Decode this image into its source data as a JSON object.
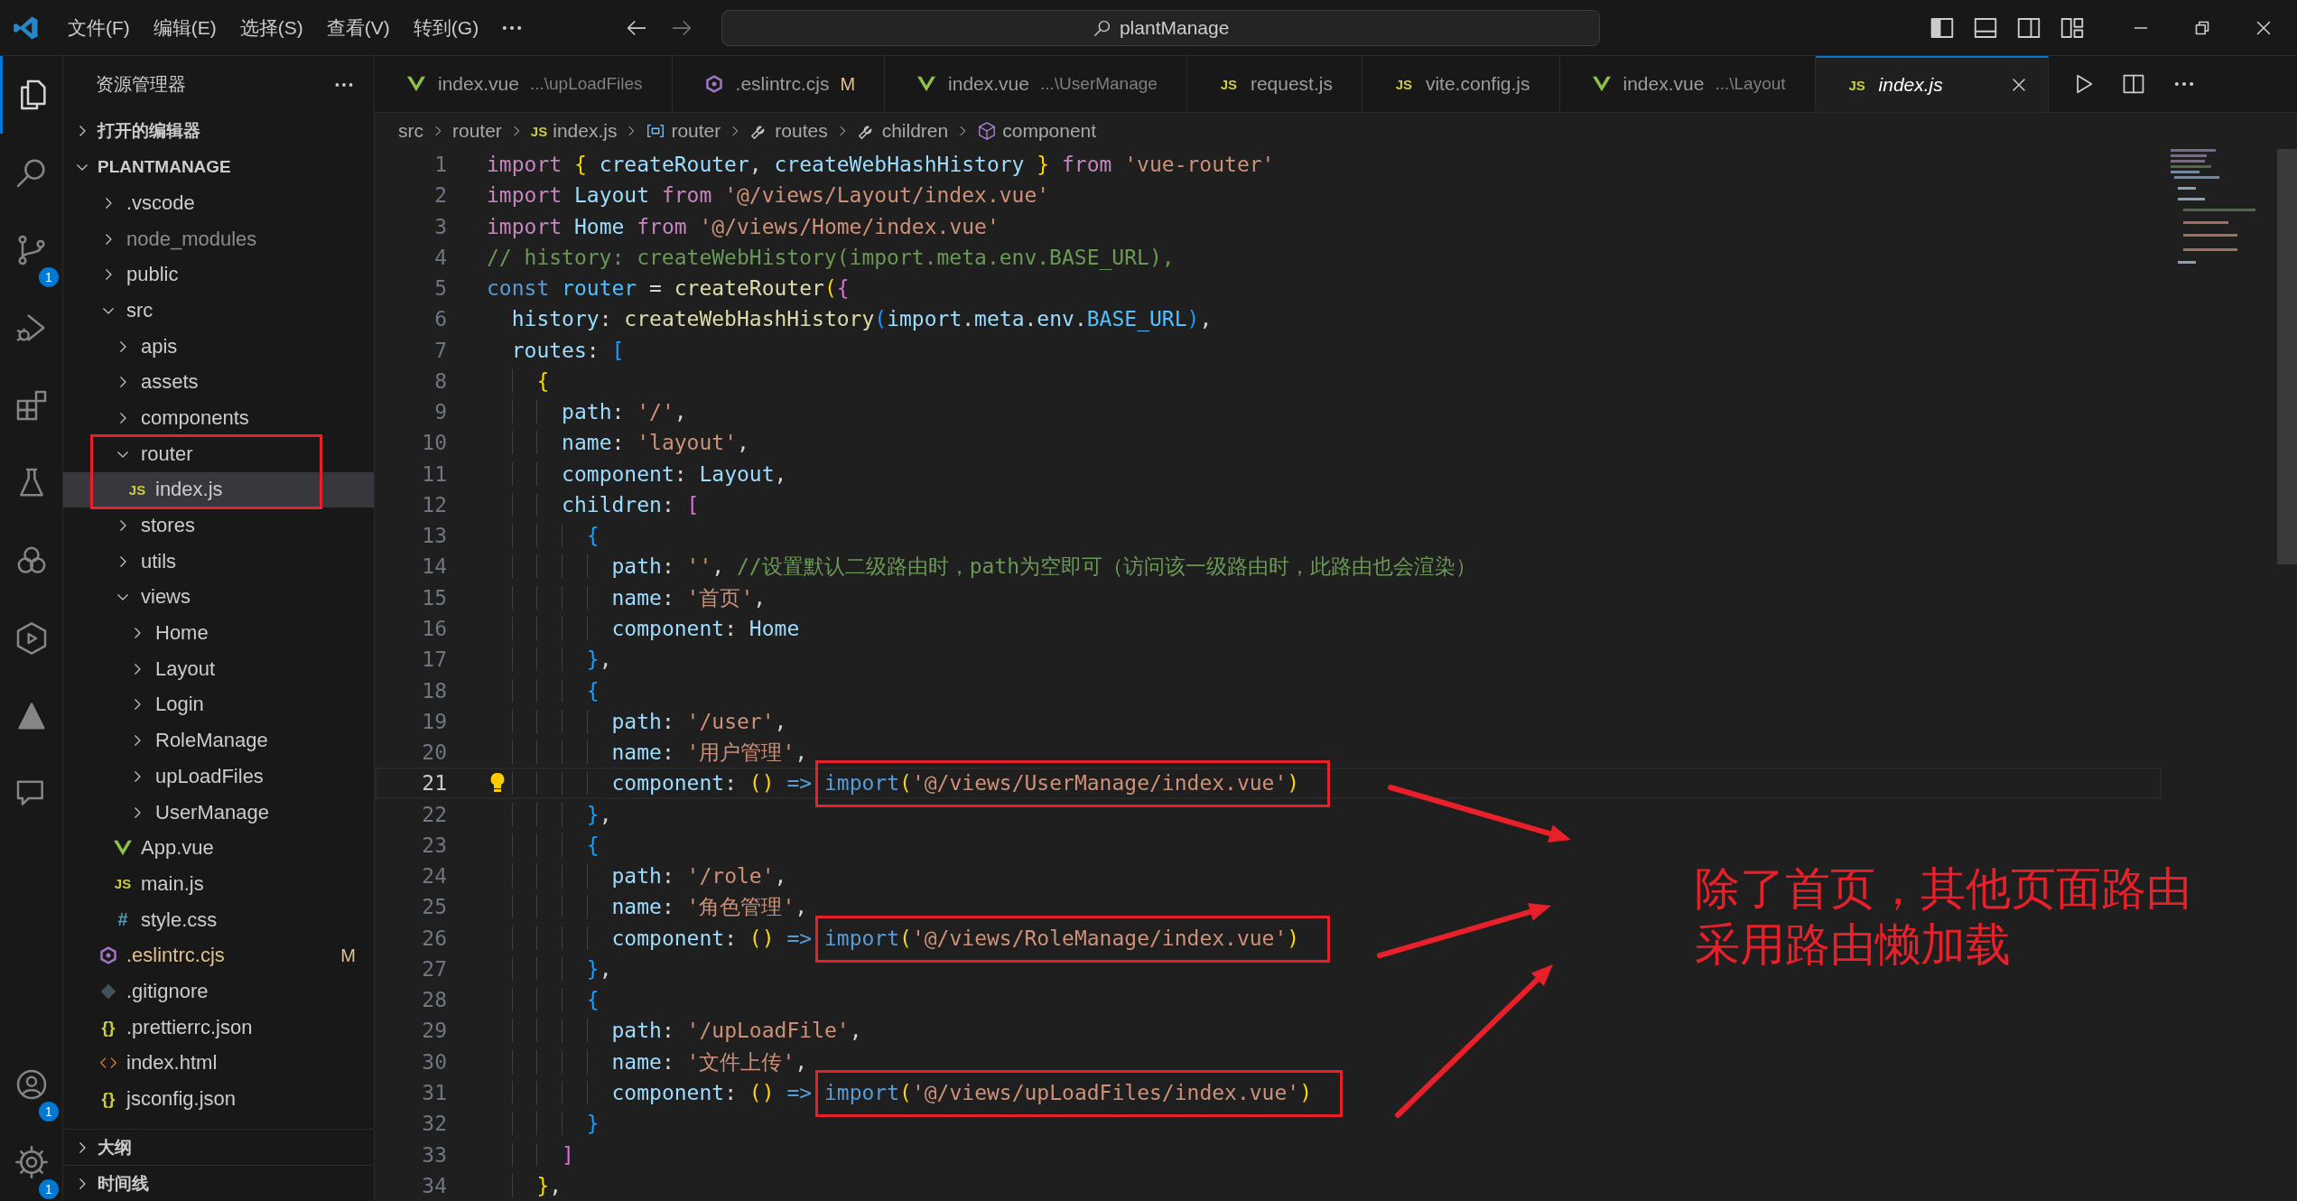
{
  "title_bar": {
    "menus": [
      "文件(F)",
      "编辑(E)",
      "选择(S)",
      "查看(V)",
      "转到(G)"
    ],
    "search": {
      "value": "plantManage"
    }
  },
  "activity_bar": {
    "items": [
      {
        "kind": "explorer",
        "selected": true
      },
      {
        "kind": "search",
        "selected": false
      },
      {
        "kind": "source-control",
        "selected": false,
        "badge": "1"
      },
      {
        "kind": "run-debug",
        "selected": false
      },
      {
        "kind": "extensions",
        "selected": false
      },
      {
        "kind": "testing",
        "selected": false
      },
      {
        "kind": "rings",
        "selected": false
      },
      {
        "kind": "hexagon",
        "selected": false
      },
      {
        "kind": "triangle",
        "selected": false
      },
      {
        "kind": "chat",
        "selected": false
      }
    ],
    "bottom_items": [
      {
        "kind": "account",
        "badge": "1"
      },
      {
        "kind": "settings",
        "badge": "1"
      }
    ]
  },
  "sidebar": {
    "title": "资源管理器",
    "sections": [
      {
        "label": "打开的编辑器",
        "expanded": false
      },
      {
        "label": "PLANTMANAGE",
        "expanded": true,
        "children": [
          {
            "label": ".vscode",
            "kind": "folder",
            "expanded": false,
            "selected": false,
            "dimmed": false
          },
          {
            "label": "node_modules",
            "kind": "folder",
            "expanded": false,
            "selected": false,
            "dimmed": true
          },
          {
            "label": "public",
            "kind": "folder",
            "expanded": false,
            "selected": false,
            "dimmed": false
          },
          {
            "label": "src",
            "kind": "folder",
            "expanded": true,
            "selected": false,
            "dimmed": false,
            "children": [
              {
                "label": "apis",
                "kind": "folder",
                "expanded": false,
                "selected": false,
                "dimmed": false
              },
              {
                "label": "assets",
                "kind": "folder",
                "expanded": false,
                "selected": false,
                "dimmed": false
              },
              {
                "label": "components",
                "kind": "folder",
                "expanded": false,
                "selected": false,
                "dimmed": false
              },
              {
                "label": "router",
                "kind": "folder",
                "expanded": true,
                "selected": false,
                "dimmed": false,
                "boxed": true,
                "children": [
                  {
                    "label": "index.js",
                    "kind": "js",
                    "icon": "JS",
                    "selected": true,
                    "dimmed": false
                  }
                ]
              },
              {
                "label": "stores",
                "kind": "folder",
                "expanded": false,
                "selected": false,
                "dimmed": false
              },
              {
                "label": "utils",
                "kind": "folder",
                "expanded": false,
                "selected": false,
                "dimmed": false
              },
              {
                "label": "views",
                "kind": "folder",
                "expanded": true,
                "selected": false,
                "dimmed": false,
                "children": [
                  {
                    "label": "Home",
                    "kind": "folder",
                    "expanded": false,
                    "selected": false,
                    "dimmed": false
                  },
                  {
                    "label": "Layout",
                    "kind": "folder",
                    "expanded": false,
                    "selected": false,
                    "dimmed": false
                  },
                  {
                    "label": "Login",
                    "kind": "folder",
                    "expanded": false,
                    "selected": false,
                    "dimmed": false
                  },
                  {
                    "label": "RoleManage",
                    "kind": "folder",
                    "expanded": false,
                    "selected": false,
                    "dimmed": false
                  },
                  {
                    "label": "upLoadFiles",
                    "kind": "folder",
                    "expanded": false,
                    "selected": false,
                    "dimmed": false
                  },
                  {
                    "label": "UserManage",
                    "kind": "folder",
                    "expanded": false,
                    "selected": false,
                    "dimmed": false
                  }
                ]
              },
              {
                "label": "App.vue",
                "kind": "vue",
                "selected": false,
                "dimmed": false
              },
              {
                "label": "main.js",
                "kind": "js",
                "icon": "JS",
                "selected": false,
                "dimmed": false
              },
              {
                "label": "style.css",
                "kind": "css",
                "icon": "#",
                "selected": false,
                "dimmed": false
              }
            ]
          },
          {
            "label": ".eslintrc.cjs",
            "kind": "eslint",
            "selected": false,
            "dimmed": false,
            "badge": "M"
          },
          {
            "label": ".gitignore",
            "kind": "git",
            "selected": false,
            "dimmed": false
          },
          {
            "label": ".prettierrc.json",
            "kind": "json",
            "icon": "{}",
            "selected": false,
            "dimmed": false
          },
          {
            "label": "index.html",
            "kind": "html",
            "selected": false,
            "dimmed": false
          },
          {
            "label": "jsconfig.json",
            "kind": "json",
            "icon": "{}",
            "selected": false,
            "dimmed": false
          }
        ]
      }
    ],
    "bottom_sections": [
      {
        "label": "大纲",
        "expanded": false
      },
      {
        "label": "时间线",
        "expanded": false
      }
    ]
  },
  "tabs": [
    {
      "label": "index.vue",
      "description": "...\\upLoadFiles",
      "kind": "vue",
      "selected": false,
      "preview": false
    },
    {
      "label": ".eslintrc.cjs",
      "kind": "eslint",
      "badge": "M",
      "selected": false,
      "preview": false
    },
    {
      "label": "index.vue",
      "description": "...\\UserManage",
      "kind": "vue",
      "selected": false,
      "preview": false
    },
    {
      "label": "request.js",
      "kind": "js",
      "icon": "JS",
      "selected": false,
      "preview": false
    },
    {
      "label": "vite.config.js",
      "kind": "js",
      "icon": "JS",
      "selected": false,
      "preview": false
    },
    {
      "label": "index.vue",
      "description": "...\\Layout",
      "kind": "vue",
      "selected": false,
      "preview": false
    },
    {
      "label": "index.js",
      "kind": "js",
      "icon": "JS",
      "selected": true,
      "preview": true
    }
  ],
  "breadcrumb": [
    {
      "label": "src",
      "kind": "plain"
    },
    {
      "label": "router",
      "kind": "plain"
    },
    {
      "label": "index.js",
      "kind": "js",
      "icon": "JS"
    },
    {
      "label": "router",
      "kind": "variable"
    },
    {
      "label": "routes",
      "kind": "property"
    },
    {
      "label": "children",
      "kind": "property"
    },
    {
      "label": "component",
      "kind": "component"
    }
  ],
  "code": [
    {
      "number": "1",
      "current": false,
      "segments": [
        {
          "kind": "k",
          "text": "import "
        },
        {
          "kind": "b1",
          "text": "{"
        },
        {
          "kind": "v",
          "text": " createRouter"
        },
        {
          "kind": "p",
          "text": ", "
        },
        {
          "kind": "v",
          "text": "createWebHashHistory "
        },
        {
          "kind": "b1",
          "text": "}"
        },
        {
          "kind": "k",
          "text": " from "
        },
        {
          "kind": "s",
          "text": "'vue-router'"
        }
      ]
    },
    {
      "number": "2",
      "current": false,
      "segments": [
        {
          "kind": "k",
          "text": "import "
        },
        {
          "kind": "v",
          "text": "Layout "
        },
        {
          "kind": "k",
          "text": "from "
        },
        {
          "kind": "s",
          "text": "'@/views/Layout/index.vue'"
        }
      ]
    },
    {
      "number": "3",
      "current": false,
      "segments": [
        {
          "kind": "k",
          "text": "import "
        },
        {
          "kind": "v",
          "text": "Home "
        },
        {
          "kind": "k",
          "text": "from "
        },
        {
          "kind": "s",
          "text": "'@/views/Home/index.vue'"
        }
      ]
    },
    {
      "number": "4",
      "current": false,
      "segments": [
        {
          "kind": "c",
          "text": "// history: createWebHistory(import.meta.env.BASE_URL),"
        }
      ]
    },
    {
      "number": "5",
      "current": false,
      "segments": [
        {
          "kind": "st",
          "text": "const "
        },
        {
          "kind": "n",
          "text": "router"
        },
        {
          "kind": "p",
          "text": " = "
        },
        {
          "kind": "f",
          "text": "createRouter"
        },
        {
          "kind": "b1",
          "text": "("
        },
        {
          "kind": "b2",
          "text": "{"
        }
      ]
    },
    {
      "number": "6",
      "current": false,
      "segments": [
        {
          "kind": "v",
          "text": "  history"
        },
        {
          "kind": "p",
          "text": ": "
        },
        {
          "kind": "f",
          "text": "createWebHashHistory"
        },
        {
          "kind": "b3",
          "text": "("
        },
        {
          "kind": "v",
          "text": "import"
        },
        {
          "kind": "p",
          "text": "."
        },
        {
          "kind": "v",
          "text": "meta"
        },
        {
          "kind": "p",
          "text": "."
        },
        {
          "kind": "v",
          "text": "env"
        },
        {
          "kind": "p",
          "text": "."
        },
        {
          "kind": "n",
          "text": "BASE_URL"
        },
        {
          "kind": "b3",
          "text": ")"
        },
        {
          "kind": "p",
          "text": ","
        }
      ]
    },
    {
      "number": "7",
      "current": false,
      "segments": [
        {
          "kind": "v",
          "text": "  routes"
        },
        {
          "kind": "p",
          "text": ": "
        },
        {
          "kind": "b3",
          "text": "["
        }
      ]
    },
    {
      "number": "8",
      "current": false,
      "segments": [
        {
          "kind": "b1",
          "text": "    {"
        }
      ]
    },
    {
      "number": "9",
      "current": false,
      "segments": [
        {
          "kind": "v",
          "text": "      path"
        },
        {
          "kind": "p",
          "text": ": "
        },
        {
          "kind": "s",
          "text": "'/'"
        },
        {
          "kind": "p",
          "text": ","
        }
      ]
    },
    {
      "number": "10",
      "current": false,
      "segments": [
        {
          "kind": "v",
          "text": "      name"
        },
        {
          "kind": "p",
          "text": ": "
        },
        {
          "kind": "s",
          "text": "'layout'"
        },
        {
          "kind": "p",
          "text": ","
        }
      ]
    },
    {
      "number": "11",
      "current": false,
      "segments": [
        {
          "kind": "v",
          "text": "      component"
        },
        {
          "kind": "p",
          "text": ": "
        },
        {
          "kind": "v",
          "text": "Layout"
        },
        {
          "kind": "p",
          "text": ","
        }
      ]
    },
    {
      "number": "12",
      "current": false,
      "segments": [
        {
          "kind": "v",
          "text": "      children"
        },
        {
          "kind": "p",
          "text": ": "
        },
        {
          "kind": "b2",
          "text": "["
        }
      ]
    },
    {
      "number": "13",
      "current": false,
      "segments": [
        {
          "kind": "b3",
          "text": "        {"
        }
      ]
    },
    {
      "number": "14",
      "current": false,
      "segments": [
        {
          "kind": "v",
          "text": "          path"
        },
        {
          "kind": "p",
          "text": ": "
        },
        {
          "kind": "s",
          "text": "''"
        },
        {
          "kind": "p",
          "text": ", "
        },
        {
          "kind": "c",
          "text": "//设置默认二级路由时，path为空即可（访问该一级路由时，此路由也会渲染）"
        }
      ]
    },
    {
      "number": "15",
      "current": false,
      "segments": [
        {
          "kind": "v",
          "text": "          name"
        },
        {
          "kind": "p",
          "text": ": "
        },
        {
          "kind": "s",
          "text": "'首页'"
        },
        {
          "kind": "p",
          "text": ","
        }
      ]
    },
    {
      "number": "16",
      "current": false,
      "segments": [
        {
          "kind": "v",
          "text": "          component"
        },
        {
          "kind": "p",
          "text": ": "
        },
        {
          "kind": "v",
          "text": "Home"
        }
      ]
    },
    {
      "number": "17",
      "current": false,
      "segments": [
        {
          "kind": "b3",
          "text": "        }"
        },
        {
          "kind": "p",
          "text": ","
        }
      ]
    },
    {
      "number": "18",
      "current": false,
      "segments": [
        {
          "kind": "b3",
          "text": "        {"
        }
      ]
    },
    {
      "number": "19",
      "current": false,
      "segments": [
        {
          "kind": "v",
          "text": "          path"
        },
        {
          "kind": "p",
          "text": ": "
        },
        {
          "kind": "s",
          "text": "'/user'"
        },
        {
          "kind": "p",
          "text": ","
        }
      ]
    },
    {
      "number": "20",
      "current": false,
      "segments": [
        {
          "kind": "v",
          "text": "          name"
        },
        {
          "kind": "p",
          "text": ": "
        },
        {
          "kind": "s",
          "text": "'用户管理'"
        },
        {
          "kind": "p",
          "text": ","
        }
      ]
    },
    {
      "number": "21",
      "current": true,
      "boxed": true,
      "segments": [
        {
          "kind": "v",
          "text": "          component"
        },
        {
          "kind": "p",
          "text": ": "
        },
        {
          "kind": "b1",
          "text": "()"
        },
        {
          "kind": "st",
          "text": " => "
        },
        {
          "kind": "call",
          "text": "import"
        },
        {
          "kind": "b1",
          "text": "("
        },
        {
          "kind": "s",
          "text": "'@/views/UserManage/index.vue'"
        },
        {
          "kind": "b1",
          "text": ")"
        }
      ]
    },
    {
      "number": "22",
      "current": false,
      "segments": [
        {
          "kind": "b3",
          "text": "        }"
        },
        {
          "kind": "p",
          "text": ","
        }
      ]
    },
    {
      "number": "23",
      "current": false,
      "segments": [
        {
          "kind": "b3",
          "text": "        {"
        }
      ]
    },
    {
      "number": "24",
      "current": false,
      "segments": [
        {
          "kind": "v",
          "text": "          path"
        },
        {
          "kind": "p",
          "text": ": "
        },
        {
          "kind": "s",
          "text": "'/role'"
        },
        {
          "kind": "p",
          "text": ","
        }
      ]
    },
    {
      "number": "25",
      "current": false,
      "segments": [
        {
          "kind": "v",
          "text": "          name"
        },
        {
          "kind": "p",
          "text": ": "
        },
        {
          "kind": "s",
          "text": "'角色管理'"
        },
        {
          "kind": "p",
          "text": ","
        }
      ]
    },
    {
      "number": "26",
      "current": false,
      "boxed": true,
      "segments": [
        {
          "kind": "v",
          "text": "          component"
        },
        {
          "kind": "p",
          "text": ": "
        },
        {
          "kind": "b1",
          "text": "()"
        },
        {
          "kind": "st",
          "text": " => "
        },
        {
          "kind": "call",
          "text": "import"
        },
        {
          "kind": "b1",
          "text": "("
        },
        {
          "kind": "s",
          "text": "'@/views/RoleManage/index.vue'"
        },
        {
          "kind": "b1",
          "text": ")"
        }
      ]
    },
    {
      "number": "27",
      "current": false,
      "segments": [
        {
          "kind": "b3",
          "text": "        }"
        },
        {
          "kind": "p",
          "text": ","
        }
      ]
    },
    {
      "number": "28",
      "current": false,
      "segments": [
        {
          "kind": "b3",
          "text": "        {"
        }
      ]
    },
    {
      "number": "29",
      "current": false,
      "segments": [
        {
          "kind": "v",
          "text": "          path"
        },
        {
          "kind": "p",
          "text": ": "
        },
        {
          "kind": "s",
          "text": "'/upLoadFile'"
        },
        {
          "kind": "p",
          "text": ","
        }
      ]
    },
    {
      "number": "30",
      "current": false,
      "segments": [
        {
          "kind": "v",
          "text": "          name"
        },
        {
          "kind": "p",
          "text": ": "
        },
        {
          "kind": "s",
          "text": "'文件上传'"
        },
        {
          "kind": "p",
          "text": ","
        }
      ]
    },
    {
      "number": "31",
      "current": false,
      "boxed": true,
      "segments": [
        {
          "kind": "v",
          "text": "          component"
        },
        {
          "kind": "p",
          "text": ": "
        },
        {
          "kind": "b1",
          "text": "()"
        },
        {
          "kind": "st",
          "text": " => "
        },
        {
          "kind": "call",
          "text": "import"
        },
        {
          "kind": "b1",
          "text": "("
        },
        {
          "kind": "s",
          "text": "'@/views/upLoadFiles/index.vue'"
        },
        {
          "kind": "b1",
          "text": ")"
        }
      ]
    },
    {
      "number": "32",
      "current": false,
      "segments": [
        {
          "kind": "b3",
          "text": "        }"
        }
      ]
    },
    {
      "number": "33",
      "current": false,
      "segments": [
        {
          "kind": "b2",
          "text": "      ]"
        }
      ]
    },
    {
      "number": "34",
      "current": false,
      "segments": [
        {
          "kind": "b1",
          "text": "    }"
        },
        {
          "kind": "p",
          "text": ","
        }
      ]
    }
  ],
  "annotation": {
    "lines": [
      "除了首页，其他页面路由",
      "采用路由懒加载"
    ]
  }
}
